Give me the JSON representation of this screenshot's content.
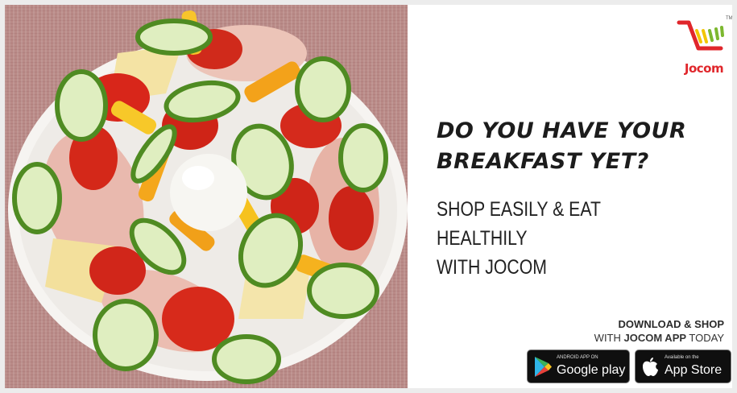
{
  "brand": {
    "name": "Jocom",
    "trademark": "TM"
  },
  "headline": {
    "line1": "DO YOU HAVE YOUR",
    "line2": "BREAKFAST YET?"
  },
  "subheadline": {
    "line1": "SHOP EASILY & EAT HEALTHILY",
    "line2": "WITH JOCOM"
  },
  "download": {
    "line1": "DOWNLOAD & SHOP",
    "line2_prefix": "WITH ",
    "line2_bold": "JOCOM APP",
    "line2_suffix": " TODAY"
  },
  "badges": {
    "google": {
      "small": "ANDROID APP ON",
      "label": "Google play",
      "icon": "google-play-icon"
    },
    "apple": {
      "small": "Available on the",
      "label": "App Store",
      "icon": "apple-icon"
    }
  },
  "colors": {
    "brand_red": "#e0262b",
    "cart_yellow": "#f2c500",
    "cart_green": "#7cb82f",
    "headline": "#1c1c1c",
    "badge_bg": "#0f0f0f"
  }
}
